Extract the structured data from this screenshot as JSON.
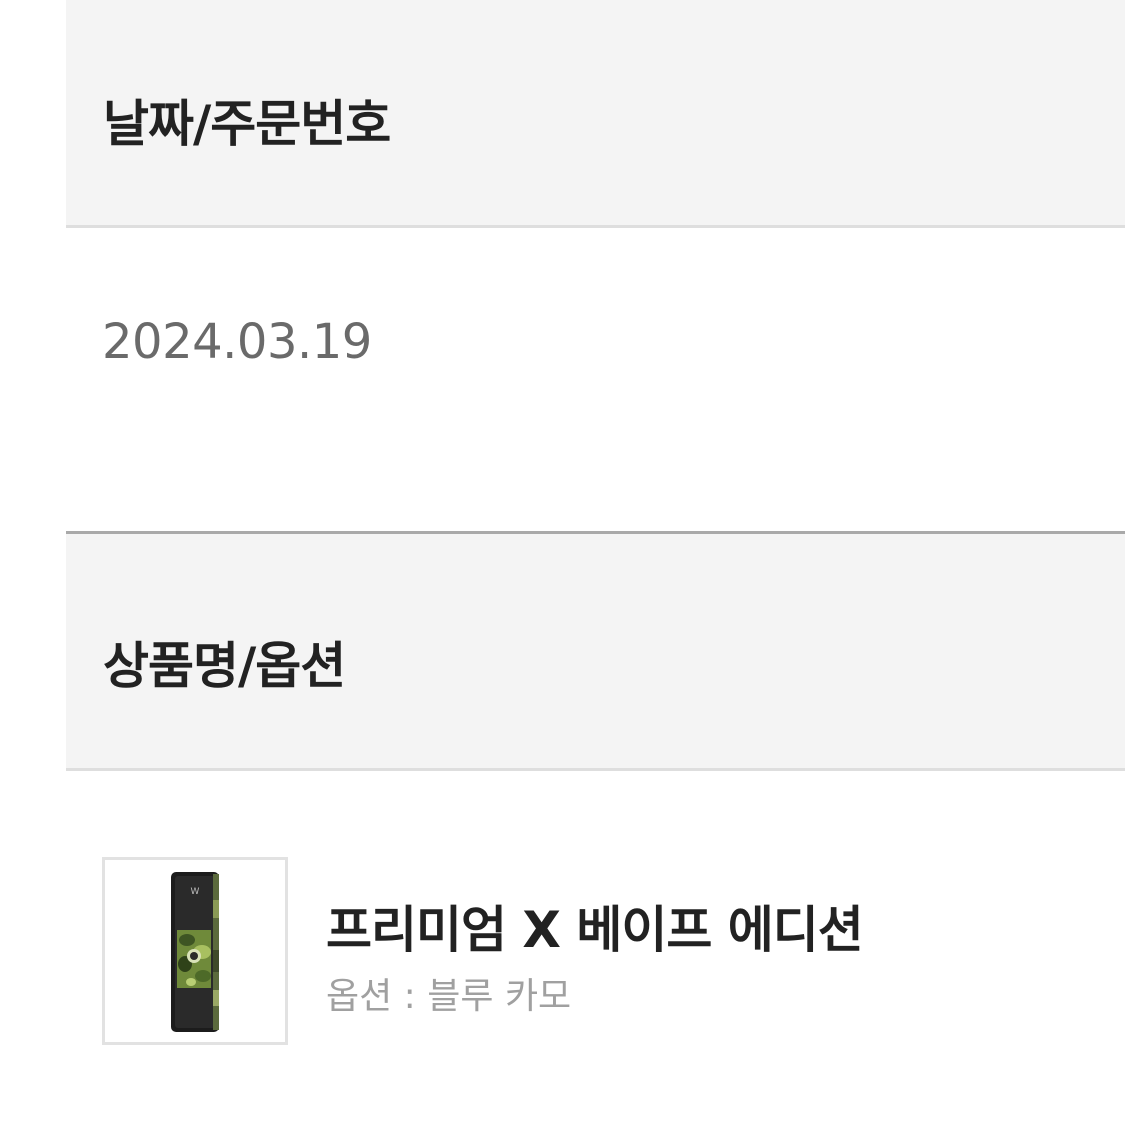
{
  "date_section": {
    "header_label": "날짜/주문번호",
    "order_date": "2024.03.19"
  },
  "product_section": {
    "header_label": "상품명/옵션",
    "items": [
      {
        "name": "프리미엄 X 베이프 에디션",
        "option": "옵션 : 블루 카모",
        "thumbnail_icon": "phone-camo-product-image"
      }
    ]
  },
  "colors": {
    "header_bg": "#f4f4f4",
    "divider": "#dedede",
    "strong_divider": "#a9a9a9",
    "primary_text": "#222222",
    "secondary_text": "#6a6a6a",
    "muted_text": "#a0a0a0"
  }
}
